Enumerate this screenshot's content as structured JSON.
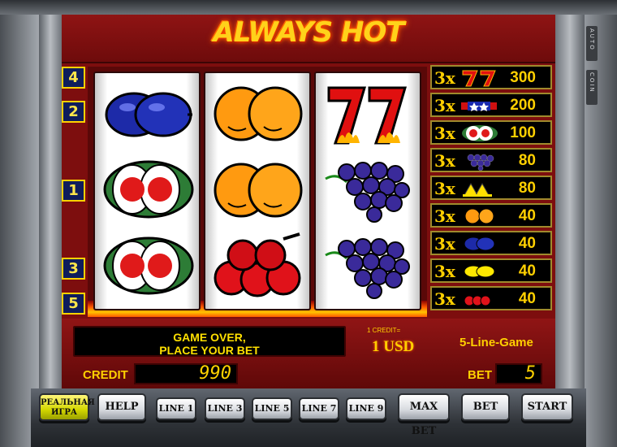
{
  "game": {
    "title": "ALWAYS HOT",
    "side_tabs": [
      "AUTO",
      "COIN"
    ]
  },
  "line_markers": [
    {
      "label": "4"
    },
    {
      "label": "2"
    },
    {
      "label": "1"
    },
    {
      "label": "3"
    },
    {
      "label": "5"
    }
  ],
  "reels": [
    {
      "symbols": [
        "plum-icon",
        "melon-icon",
        "melon-icon"
      ]
    },
    {
      "symbols": [
        "orange-icon",
        "orange-icon",
        "cherry-icon"
      ]
    },
    {
      "symbols": [
        "seven-icon",
        "grapes-icon",
        "grapes-icon"
      ]
    }
  ],
  "paytable": [
    {
      "mult": "3x",
      "symbol": "seven-icon",
      "pay": "300"
    },
    {
      "mult": "3x",
      "symbol": "star-icon",
      "pay": "200"
    },
    {
      "mult": "3x",
      "symbol": "melon-icon",
      "pay": "100"
    },
    {
      "mult": "3x",
      "symbol": "grapes-icon",
      "pay": "80"
    },
    {
      "mult": "3x",
      "symbol": "bell-icon",
      "pay": "80"
    },
    {
      "mult": "3x",
      "symbol": "orange-icon",
      "pay": "40"
    },
    {
      "mult": "3x",
      "symbol": "plum-icon",
      "pay": "40"
    },
    {
      "mult": "3x",
      "symbol": "lemon-icon",
      "pay": "40"
    },
    {
      "mult": "3x",
      "symbol": "cherry-icon",
      "pay": "40"
    }
  ],
  "info": {
    "message_line1": "GAME OVER,",
    "message_line2": "PLACE YOUR BET",
    "credit_rate_label": "1 CREDIT=",
    "credit_rate_value": "1 USD",
    "mode": "5-Line-Game",
    "credit_label": "CREDIT",
    "credit_value": "990",
    "bet_label": "BET",
    "bet_value": "5"
  },
  "buttons": {
    "real_game_line1": "РЕАЛЬНАЯ",
    "real_game_line2": "ИГРА",
    "help": "HELP",
    "line1": "LINE 1",
    "line3": "LINE 3",
    "line5": "LINE 5",
    "line7": "LINE 7",
    "line9": "LINE 9",
    "max_bet": "MAX BET",
    "bet": "BET",
    "start": "START"
  },
  "colors": {
    "screen": "#7d0e0e",
    "gold": "#ffd000",
    "line_badge": "#0e1d5c"
  }
}
